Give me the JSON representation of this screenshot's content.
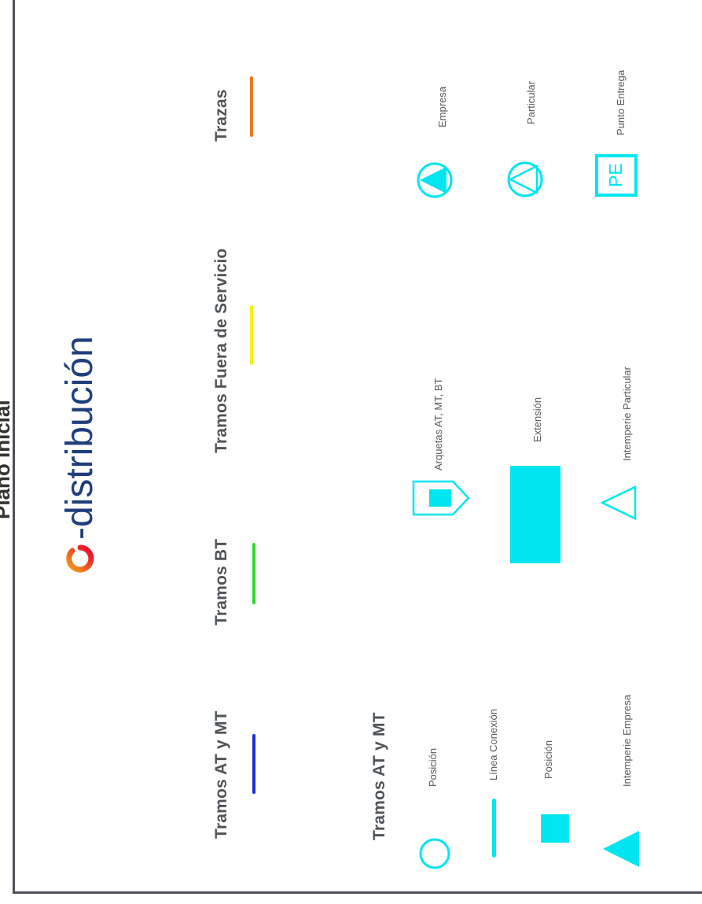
{
  "page_title": "Plano Inicial",
  "brand": {
    "text": "-distribución",
    "color": "#1f3e7d",
    "logo_colors": [
      "#e4002b",
      "#f7a21b"
    ]
  },
  "legend_lines": [
    {
      "label": "Tramos AT y MT",
      "color": "#1a2fd6"
    },
    {
      "label": "Tramos BT",
      "color": "#2fd82a"
    },
    {
      "label": "Tramos Fuera de Servicio",
      "color": "#f3f21e"
    },
    {
      "label": "Trazas",
      "color": "#ea7a21"
    }
  ],
  "symbols_section": {
    "title": "Tramos AT y MT",
    "accent_color": "#00e6f0",
    "items": [
      {
        "label": "Posición",
        "icon": "circle-outline-icon"
      },
      {
        "label": "Línea Conexión",
        "icon": "line-icon"
      },
      {
        "label": "Posición",
        "icon": "filled-square-icon"
      },
      {
        "label": "Intemperie Empresa",
        "icon": "filled-triangle-icon"
      },
      {
        "label": "Arquetas AT, MT, BT",
        "icon": "house-icon"
      },
      {
        "label": "Extensión",
        "icon": "filled-rectangle-icon"
      },
      {
        "label": "Intemperie Particular",
        "icon": "triangle-outline-icon"
      },
      {
        "label": "Empresa",
        "icon": "circle-filled-triangle-icon"
      },
      {
        "label": "Particular",
        "icon": "circle-triangle-outline-icon"
      },
      {
        "label": "Punto Entrega",
        "icon": "pe-box-icon",
        "box_text": "PE"
      }
    ]
  }
}
